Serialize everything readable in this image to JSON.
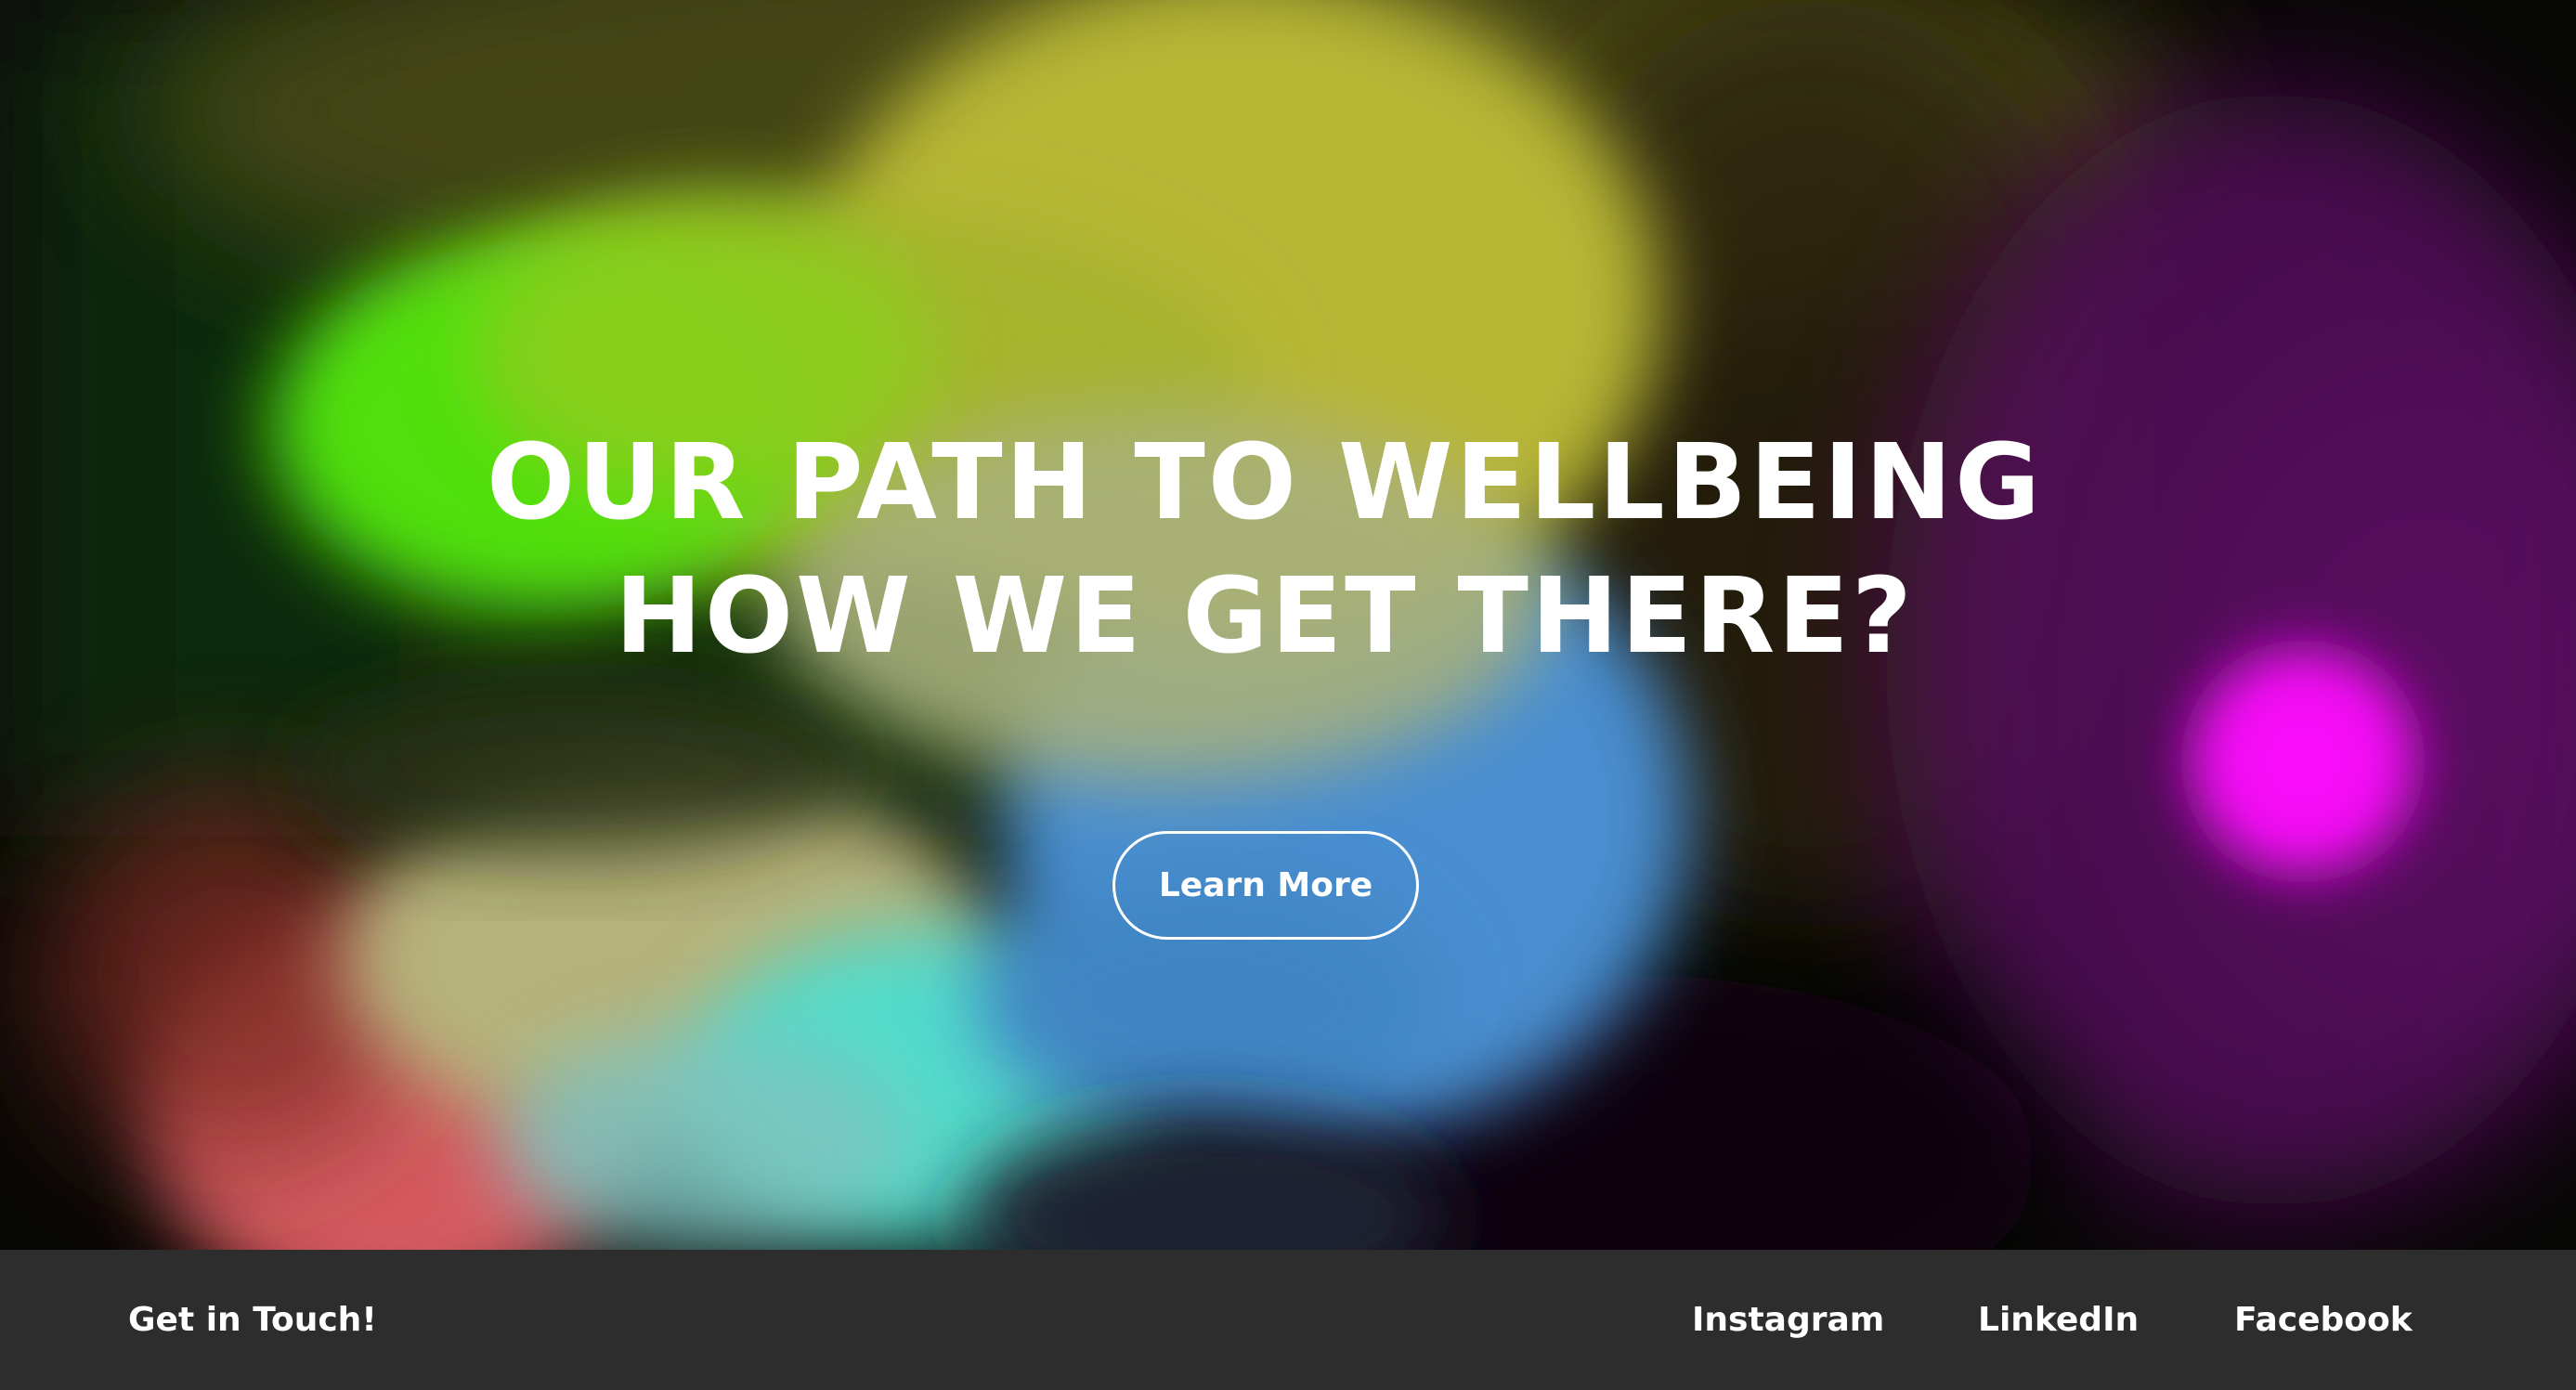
{
  "hero": {
    "title_line1": "OUR PATH TO WELLBEING",
    "title_line2": "HOW WE GET THERE?",
    "cta_label": "Learn More"
  },
  "footer": {
    "contact_label": "Get in Touch!",
    "links": [
      {
        "label": "Instagram"
      },
      {
        "label": "LinkedIn"
      },
      {
        "label": "Facebook"
      }
    ],
    "background_color": "#2d2d2d"
  },
  "colors": {
    "green_blob": "#4fe00e",
    "yellow_blob": "#b8b635",
    "blue_blob": "#4a8ed0",
    "teal_blob": "#52dccb",
    "red_blob": "#d65c62",
    "magenta_glow": "#f20cf4",
    "purple_bg": "#55105c"
  }
}
